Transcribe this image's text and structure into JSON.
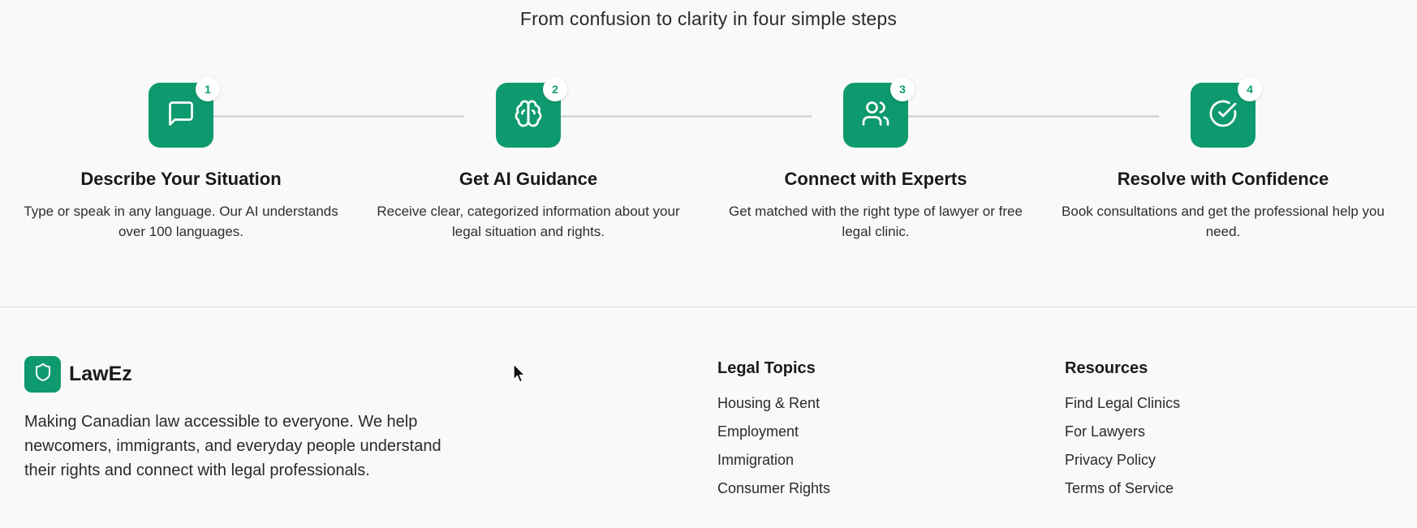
{
  "steps_section": {
    "subtitle": "From confusion to clarity in four simple steps",
    "steps": [
      {
        "number": "1",
        "icon": "message-square-icon",
        "title": "Describe Your Situation",
        "description": "Type or speak in any language. Our AI understands over 100 languages."
      },
      {
        "number": "2",
        "icon": "brain-icon",
        "title": "Get AI Guidance",
        "description": "Receive clear, categorized information about your legal situation and rights."
      },
      {
        "number": "3",
        "icon": "users-icon",
        "title": "Connect with Experts",
        "description": "Get matched with the right type of lawyer or free legal clinic."
      },
      {
        "number": "4",
        "icon": "check-circle-icon",
        "title": "Resolve with Confidence",
        "description": "Book consultations and get the professional help you need."
      }
    ]
  },
  "footer": {
    "brand": {
      "name": "LawEz",
      "icon": "shield-icon",
      "description": "Making Canadian law accessible to everyone. We help newcomers, immigrants, and everyday people understand their rights and connect with legal professionals."
    },
    "legal_topics": {
      "heading": "Legal Topics",
      "links": [
        "Housing & Rent",
        "Employment",
        "Immigration",
        "Consumer Rights"
      ]
    },
    "resources": {
      "heading": "Resources",
      "links": [
        "Find Legal Clinics",
        "For Lawyers",
        "Privacy Policy",
        "Terms of Service"
      ]
    }
  },
  "colors": {
    "accent": "#0e9a6e",
    "background": "#f9f9f9",
    "connector": "#d9d9d9"
  }
}
